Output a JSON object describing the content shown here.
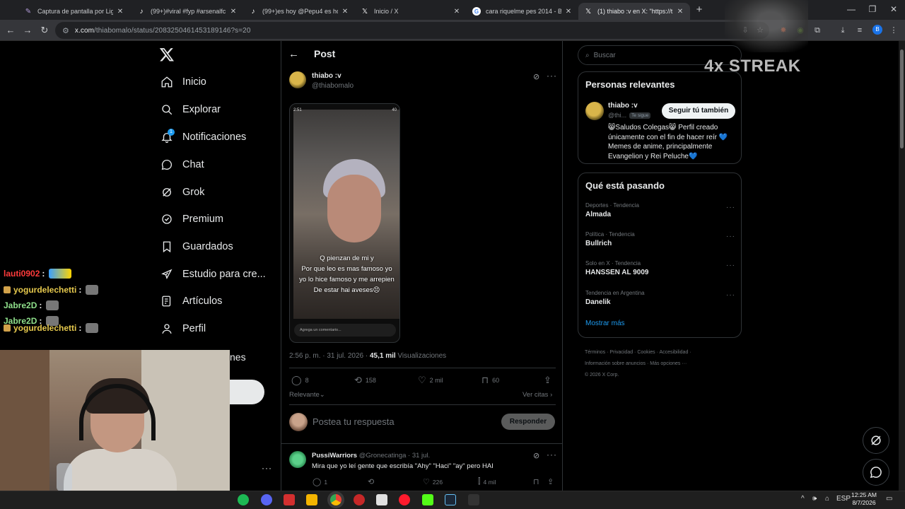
{
  "browser": {
    "tabs": [
      {
        "title": "Captura de pantalla por Lightsh",
        "icon": "feather-icon"
      },
      {
        "title": "(99+)#viral #fyp #arsenalfc wha",
        "icon": "tiktok-icon"
      },
      {
        "title": "(99+)es hoy @Pepu4 es hoy #b",
        "icon": "tiktok-icon"
      },
      {
        "title": "Inicio / X",
        "icon": "x-icon"
      },
      {
        "title": "cara riquelme pes 2014 - Busca",
        "icon": "google-icon"
      },
      {
        "title": "(1) thiabo :v en X: \"https://t.co/",
        "icon": "x-icon"
      }
    ],
    "url_host": "x.com",
    "url_path": "/thiabomalo/status/2083250461453189146?s=20"
  },
  "nav": {
    "items": [
      {
        "label": "Inicio",
        "icon": "home-icon"
      },
      {
        "label": "Explorar",
        "icon": "search-icon"
      },
      {
        "label": "Notificaciones",
        "icon": "bell-icon"
      },
      {
        "label": "Chat",
        "icon": "chat-icon"
      },
      {
        "label": "Grok",
        "icon": "grok-icon"
      },
      {
        "label": "Premium",
        "icon": "premium-icon"
      },
      {
        "label": "Guardados",
        "icon": "bookmark-icon"
      },
      {
        "label": "Estudio para cre...",
        "icon": "rocket-icon"
      },
      {
        "label": "Artículos",
        "icon": "article-icon"
      },
      {
        "label": "Perfil",
        "icon": "person-icon"
      }
    ],
    "notif_count": "1",
    "partial_label": "nes"
  },
  "post": {
    "header_title": "Post",
    "author_name": "thiabo :v",
    "author_handle": "@thiabomalo",
    "phone_time": "2:51",
    "phone_battery": "40",
    "caption_lines": [
      "Q pienzan de mi y",
      "Por que leo es mas famoso yo",
      "yo lo hice famoso y me arrepien",
      "De estar hai aveses😣"
    ],
    "comment_placeholder": "Agrega un comentario...",
    "meta_time": "2:56 p. m. · 31 jul. 2026 · ",
    "meta_views": "45,1 mil",
    "meta_views_label": " Visualizaciones",
    "replies": "8",
    "reposts": "158",
    "likes": "2 mil",
    "bookmarks": "60",
    "sort_label": "Relevante⌄",
    "quotes_label": "Ver citas ›",
    "reply_placeholder": "Postea tu respuesta",
    "reply_button": "Responder"
  },
  "reply": {
    "name": "PussiWarriors",
    "handle_date": " @Gronecatinga · 31 jul.",
    "text": "Mira que yo leí gente que escribía \"Ahy\" \"Haci\" \"ay\"  pero HAI",
    "replies": "1",
    "likes": "226",
    "views": "4 mil"
  },
  "sidebar": {
    "search_placeholder": "Buscar",
    "relevant_title": "Personas relevantes",
    "rel_name": "thiabo :v",
    "rel_handle": "@thi...",
    "rel_badge": "Te sigue",
    "follow_button": "Seguir tú también",
    "rel_bio": "😸Saludos Colegas😸 Perfil creado únicamente con el fin de hacer reír 💙 Memes de anime, principalmente Evangelion y Rei Peluche💙",
    "trends_title": "Qué está pasando",
    "trends": [
      {
        "context": "Deportes · Tendencia",
        "name": "Almada"
      },
      {
        "context": "Política · Tendencia",
        "name": "Bullrich"
      },
      {
        "context": "Solo en X · Tendencia",
        "name": "HANSSEN AL 9009"
      },
      {
        "context": "Tendencia en Argentina",
        "name": "Danelik"
      }
    ],
    "show_more": "Mostrar más",
    "footer": [
      "Términos",
      "Privacidad",
      "Cookies",
      "Accesibilidad",
      "Información sobre anuncios",
      "Más opciones ···",
      "© 2026 X Corp."
    ]
  },
  "overlay": {
    "streak": "4x STREAK",
    "chat": [
      {
        "user": "lauti0902",
        "color": "#ff3b3b"
      },
      {
        "user": "yogurdelechetti",
        "color": "#e6c94d"
      },
      {
        "user": "Jabre2D",
        "color": "#8fe08b"
      },
      {
        "user": "Jabre2D",
        "color": "#8fe08b"
      },
      {
        "user": "yogurdelechetti",
        "color": "#e6c94d"
      }
    ]
  },
  "taskbar": {
    "lang": "ESP",
    "time": "12:25 AM",
    "date": "8/7/2026"
  }
}
